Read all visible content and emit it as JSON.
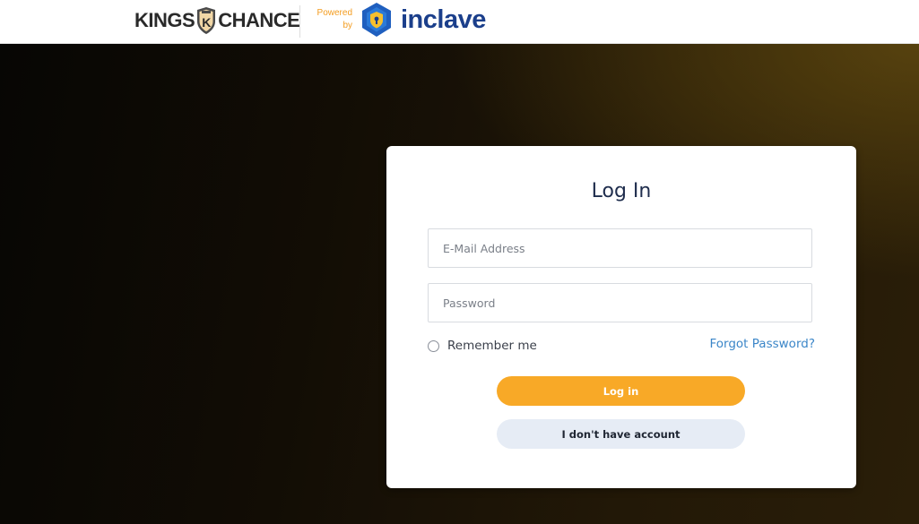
{
  "header": {
    "brand_left": "KINGS",
    "brand_shield_letter": "K",
    "brand_right": "CHANCE",
    "powered_line1": "Powered",
    "powered_line2": "by",
    "partner_name": "inclave",
    "brand_icon": "shield-k-icon",
    "partner_icon": "inclave-shield-icon"
  },
  "login": {
    "title": "Log In",
    "email_placeholder": "E-Mail Address",
    "password_placeholder": "Password",
    "remember_label": "Remember me",
    "forgot_label": "Forgot Password?",
    "login_button": "Log in",
    "no_account_button": "I don't have account"
  },
  "colors": {
    "accent": "#f8a927",
    "link": "#3b86c8",
    "secondary_button": "#e6ecf5",
    "partner": "#1b3f8b"
  }
}
